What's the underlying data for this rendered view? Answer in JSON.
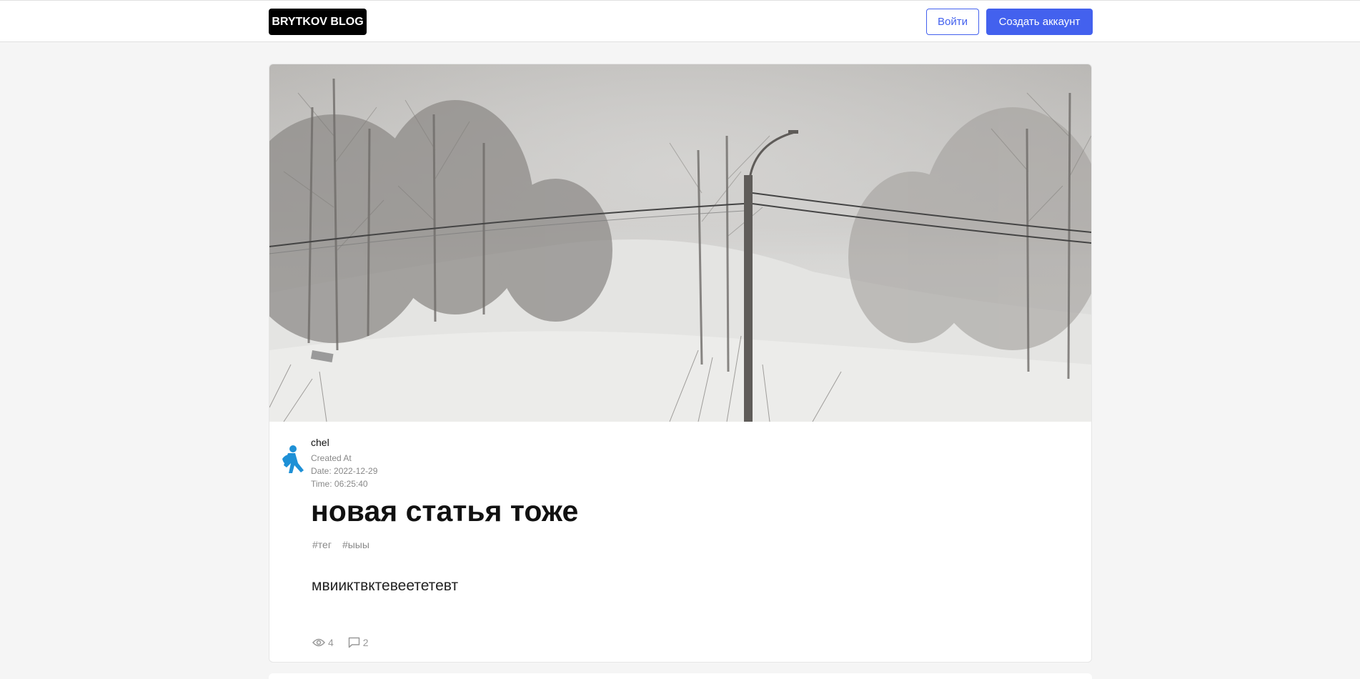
{
  "header": {
    "logo": "BRYTKOV BLOG",
    "login_label": "Войти",
    "register_label": "Создать аккаунт"
  },
  "post": {
    "image_alt": "snowy landscape with trees and a utility pole",
    "author": {
      "name": "chel",
      "created_label": "Created At",
      "date": "Date: 2022-12-29",
      "time": "Time: 06:25:40"
    },
    "title": "новая статья тоже",
    "tags": [
      "#тег",
      "#ыыы"
    ],
    "text": "мвииктвктевеететевт",
    "views": "4",
    "comments": "2"
  },
  "colors": {
    "accent": "#4361ee",
    "logo_bg": "#000000",
    "avatar_blue": "#1e90d6"
  },
  "icons": {
    "views": "eye-icon",
    "comments": "comment-icon"
  }
}
